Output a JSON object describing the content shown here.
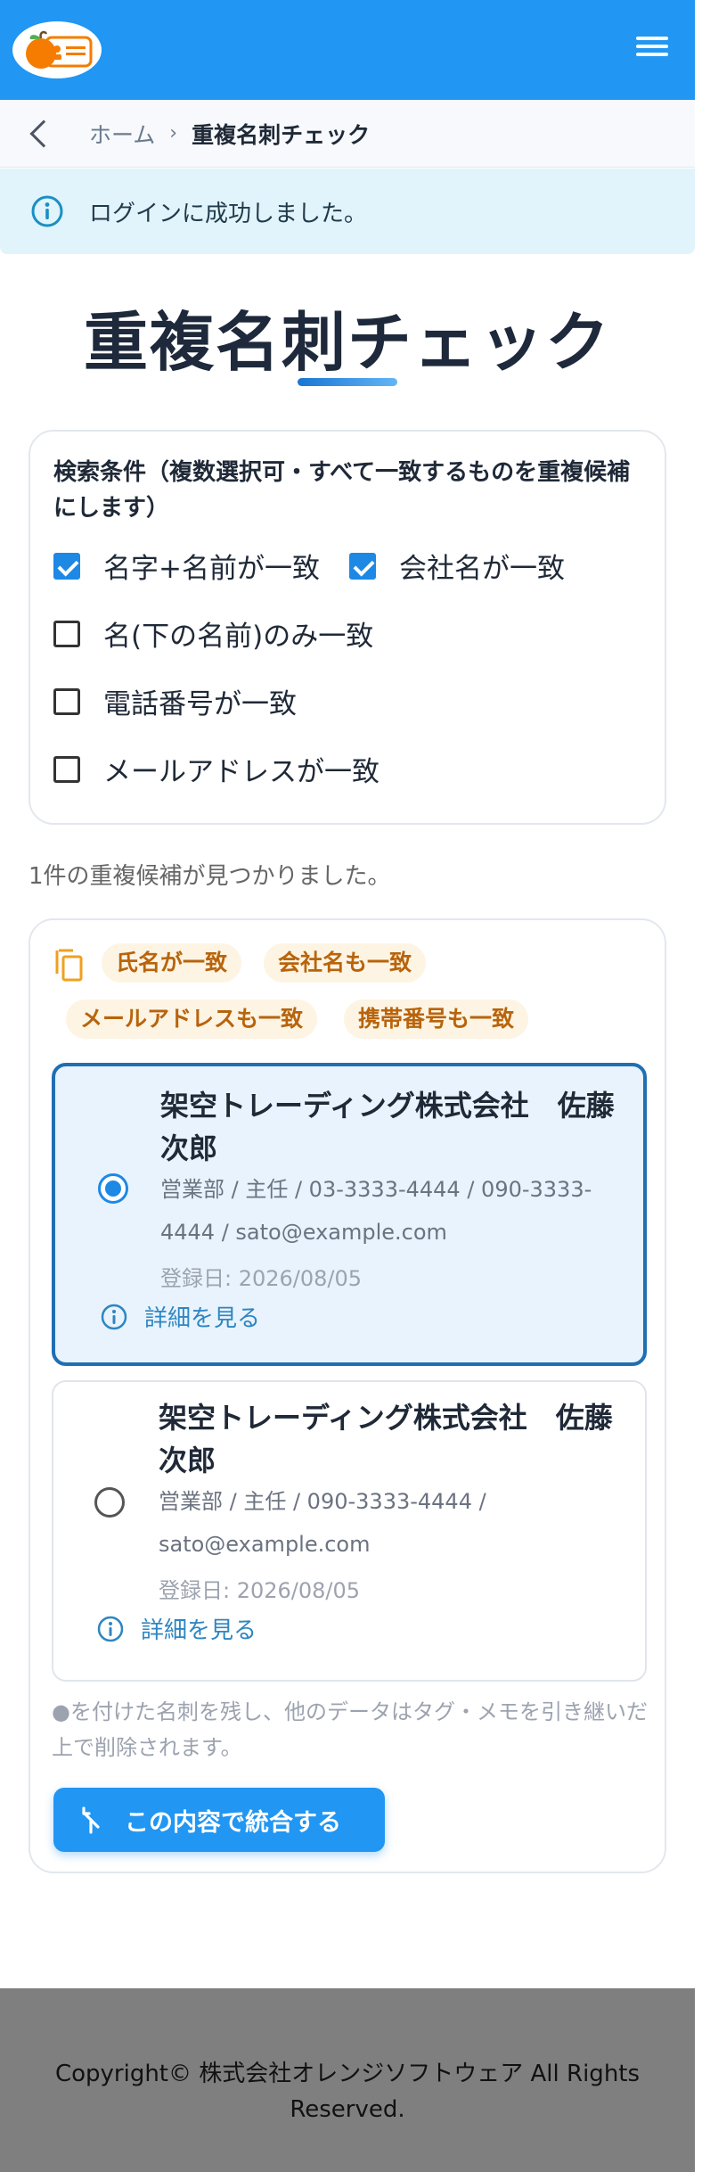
{
  "header": {
    "logo_label": "logo",
    "menu_icon": "hamburger-menu-icon"
  },
  "breadcrumb": {
    "back_icon": "chevron-left-icon",
    "home": "ホーム",
    "separator": "›",
    "current": "重複名刺チェック"
  },
  "alert": {
    "icon": "info-icon",
    "message": "ログインに成功しました。"
  },
  "page": {
    "title": "重複名刺チェック"
  },
  "conditions": {
    "title": "検索条件（複数選択可・すべて一致するものを重複候補にします）",
    "options": [
      {
        "label": "名字+名前が一致",
        "checked": true
      },
      {
        "label": "会社名が一致",
        "checked": true
      },
      {
        "label": "名(下の名前)のみ一致",
        "checked": false
      },
      {
        "label": "電話番号が一致",
        "checked": false
      },
      {
        "label": "メールアドレスが一致",
        "checked": false
      }
    ]
  },
  "result": {
    "message": "1件の重複候補が見つかりました。"
  },
  "duplicate_group": {
    "icon": "copy-icon",
    "tags": [
      "氏名が一致",
      "会社名も一致",
      "メールアドレスも一致",
      "携帯番号も一致"
    ],
    "candidates": [
      {
        "selected": true,
        "name": "架空トレーディング株式会社　佐藤 次郎",
        "detail": "営業部 / 主任 / 03-3333-4444 / 090-3333-4444 / sato@example.com",
        "date": "登録日: 2026/08/05",
        "link": "詳細を見る"
      },
      {
        "selected": false,
        "name": "架空トレーディング株式会社　佐藤 次郎",
        "detail": "営業部 / 主任 / 090-3333-4444 / sato@example.com",
        "date": "登録日: 2026/08/05",
        "link": "詳細を見る"
      }
    ],
    "note": "●を付けた名刺を残し、他のデータはタグ・メモを引き継いだ上で削除されます。",
    "merge_button": "この内容で統合する"
  },
  "footer": {
    "copyright": "Copyright© 株式会社オレンジソフトウェア All Rights Reserved."
  },
  "colors": {
    "primary": "#2196f3",
    "tag_bg": "#fdf4e3",
    "tag_text": "#b8640c",
    "alert_bg": "#e1f3fb",
    "footer_bg": "#7f7f7f"
  }
}
